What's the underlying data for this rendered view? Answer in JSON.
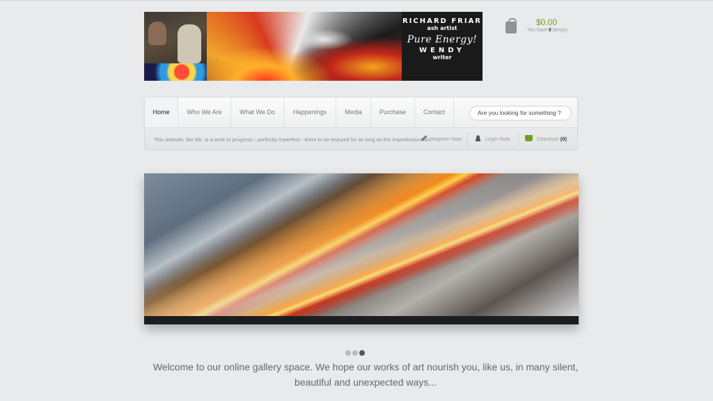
{
  "header": {
    "artist_name": "RICHARD FRIAR",
    "artist_role": "ash artist",
    "tagline": "Pure Energy!",
    "writer_name": "WENDY",
    "writer_role": "writer"
  },
  "cart": {
    "total": "$0.00",
    "prefix": "You have ",
    "count": "0",
    "suffix": " item(s)"
  },
  "nav": {
    "items": [
      {
        "label": "Home"
      },
      {
        "label": "Who We Are"
      },
      {
        "label": "What We Do"
      },
      {
        "label": "Happenings"
      },
      {
        "label": "Media"
      },
      {
        "label": "Purchase"
      },
      {
        "label": "Contact"
      }
    ],
    "search_placeholder": "Are you looking for something ?"
  },
  "subbar": {
    "motto": "This website, like life, is a work in progress - perfectly imperfect - there to be enjoyed for as long as the imperfection last.",
    "register": "Register Now",
    "login": "Login Now",
    "checkout": "Checkout",
    "checkout_count": "(0)"
  },
  "slider": {
    "slide_count": 3,
    "active_slide": 3
  },
  "welcome": {
    "line1": "Welcome to our online gallery space. We hope our works of art nourish you, like us, in many silent,",
    "line2": "beautiful and unexpected ways..."
  }
}
